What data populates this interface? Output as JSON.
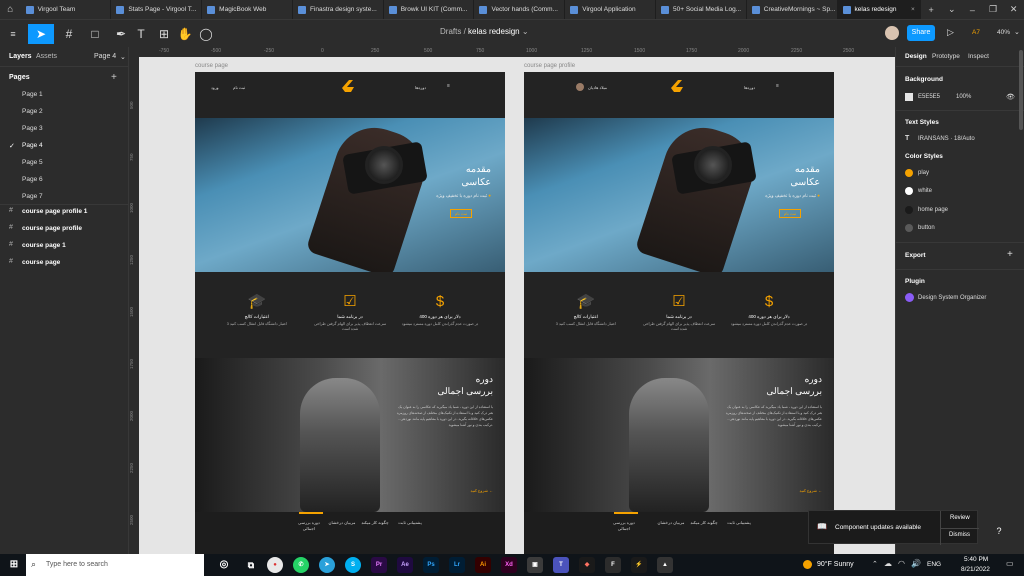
{
  "tabs": [
    {
      "label": "Virgool Team"
    },
    {
      "label": "Stats Page - Virgool T..."
    },
    {
      "label": "MagicBook Web"
    },
    {
      "label": "Finastra design syste..."
    },
    {
      "label": "Browk UI KIT (Comm..."
    },
    {
      "label": "Vector hands (Comm..."
    },
    {
      "label": "Virgool Application"
    },
    {
      "label": "50+ Social Media Log..."
    },
    {
      "label": "CreativeMornings ~ Sp..."
    },
    {
      "label": "kelas redesign",
      "active": true
    }
  ],
  "breadcrumb": {
    "parent": "Drafts",
    "sep": "/",
    "file": "kelas redesign"
  },
  "toolbar": {
    "share": "Share",
    "user_initials": "A7",
    "zoom": "40%"
  },
  "left_panel": {
    "tab_layers": "Layers",
    "tab_assets": "Assets",
    "current_page": "Page 4",
    "pages_heading": "Pages",
    "pages": [
      "Page 1",
      "Page 2",
      "Page 3",
      "Page 4",
      "Page 5",
      "Page 6",
      "Page 7"
    ],
    "active_page_index": 3,
    "frames": [
      "course page profile 1",
      "course page profile",
      "course page 1",
      "course page"
    ]
  },
  "right_panel": {
    "tabs": [
      "Design",
      "Prototype",
      "Inspect"
    ],
    "background_heading": "Background",
    "background_hex": "E5E5E5",
    "background_opacity": "100%",
    "text_styles_heading": "Text Styles",
    "text_style": "IRANSANS · 18/Auto",
    "color_styles_heading": "Color Styles",
    "color_styles": [
      {
        "name": "play",
        "color": "#f5a200"
      },
      {
        "name": "white",
        "color": "#ffffff"
      },
      {
        "name": "home page",
        "color": "#1a1a1a"
      },
      {
        "name": "button",
        "color": "#5a5a5a"
      }
    ],
    "export_heading": "Export",
    "plugin_heading": "Plugin",
    "plugin_name": "Design System Organizer"
  },
  "canvas": {
    "ruler_labels": [
      "-750",
      "-500",
      "-250",
      "0",
      "250",
      "500",
      "750",
      "1000",
      "1250",
      "1500",
      "1750",
      "2000",
      "2250",
      "2500"
    ],
    "vruler_labels": [
      "500",
      "750",
      "1000",
      "1250",
      "1500",
      "1750",
      "2000",
      "2250",
      "2500"
    ],
    "frame_labels": [
      "course page",
      "course page profile"
    ],
    "mockup": {
      "nav_left": "ثبت نام",
      "nav_left2": "ورود",
      "nav_right": "دوره‌ها",
      "profile_name": "میلاد هادیان",
      "hero_title_1": "مقدمه",
      "hero_title_2": "عکاسی",
      "hero_subtitle": "ثبت نام دوره با تخفیف ویژه",
      "hero_button": "ثبت نام",
      "features": [
        {
          "icon": "$",
          "title": "400 دلار برای هر دوره",
          "desc": "در صورت عدم گذراندن کامل دوره مسترد میشود"
        },
        {
          "icon": "☑",
          "title": "در برنامه شما",
          "desc": "سرعت انعطاف پذیر برای الهام گرفتن طراحی شده است"
        },
        {
          "icon": "🎓",
          "title": "اعتبارات کالج",
          "desc": "3 اعتبار دانشگاه قابل انتقال کسب کنید"
        }
      ],
      "section_title_1": "دوره",
      "section_title_2": "بررسی اجمالی",
      "section_text": "با استفاده از این دوره ، شما یاد میگیرید که عکاسی را به عنوان یک هنر درک کنید و با استفاده از تکنیک‌های مختلف از صحنه‌های روزمره عکس‌های خلاقانه بگیرید. در این دوره با مفاهیم پایه مانند نوردهی ، ترکیب بندی و نور آشنا میشوید.",
      "section_button": "شروع کنید",
      "footer_links": [
        "دوره بررسی اجمالی",
        "مربیان درخشان",
        "چگونه کار میکند",
        "پشتیبانی ثابت"
      ]
    }
  },
  "toast": {
    "message": "Component updates available",
    "review": "Review",
    "dismiss": "Dismiss"
  },
  "help": "?",
  "taskbar": {
    "search_placeholder": "Type here to search",
    "weather": "90°F  Sunny",
    "lang": "ENG",
    "time": "5:40 PM",
    "date": "8/21/2022"
  }
}
